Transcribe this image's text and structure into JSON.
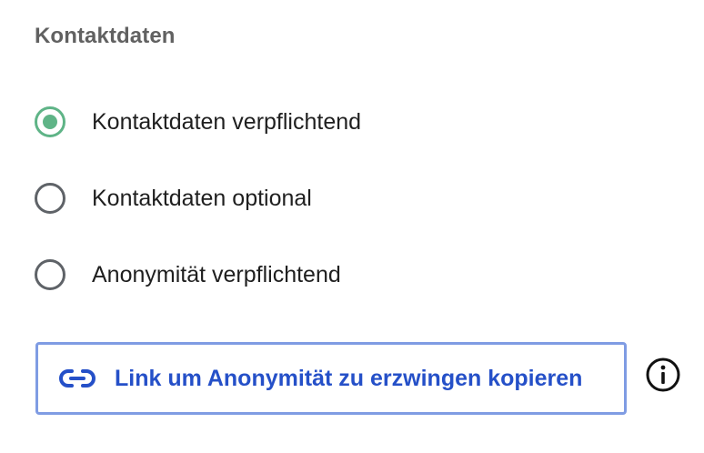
{
  "section": {
    "title": "Kontaktdaten"
  },
  "radio_group": {
    "selected_index": 0,
    "options": [
      {
        "label": "Kontaktdaten verpflichtend",
        "checked": true
      },
      {
        "label": "Kontaktdaten optional",
        "checked": false
      },
      {
        "label": "Anonymität verpflichtend",
        "checked": false
      }
    ]
  },
  "copy_button": {
    "label": "Link um Anonymität zu erzwingen kopieren",
    "icon": "link-icon"
  },
  "info": {
    "icon": "info-icon"
  },
  "colors": {
    "accent_green": "#5fb487",
    "link_blue": "#2550c8",
    "button_border": "#7f9ce3",
    "title_gray": "#616161"
  }
}
